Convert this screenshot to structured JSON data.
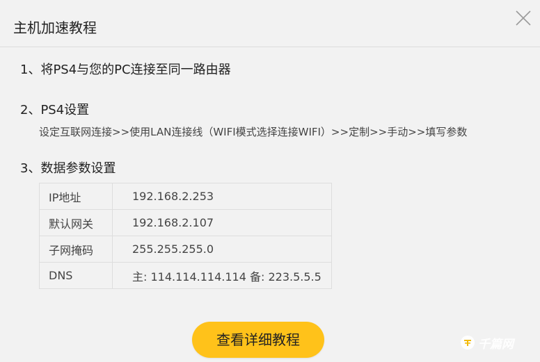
{
  "dialog": {
    "title": "主机加速教程",
    "close_icon": "close-icon"
  },
  "steps": [
    {
      "title": "1、将PS4与您的PC连接至同一路由器"
    },
    {
      "title": "2、PS4设置",
      "desc": "设定互联网连接>>使用LAN连接线（WIFI模式选择连接WIFI）>>定制>>手动>>填写参数"
    },
    {
      "title": "3、数据参数设置"
    }
  ],
  "params": [
    {
      "key": "IP地址",
      "value": "192.168.2.253"
    },
    {
      "key": "默认网关",
      "value": "192.168.2.107"
    },
    {
      "key": "子网掩码",
      "value": "255.255.255.0"
    },
    {
      "key": "DNS",
      "value": "主: 114.114.114.114 备: 223.5.5.5"
    }
  ],
  "button": {
    "label": "查看详细教程"
  },
  "watermark": {
    "text": "千篇网"
  },
  "colors": {
    "background": "#f2f2f2",
    "accent_button": "#ffc21a",
    "text": "#222222",
    "border": "#dddddd"
  }
}
